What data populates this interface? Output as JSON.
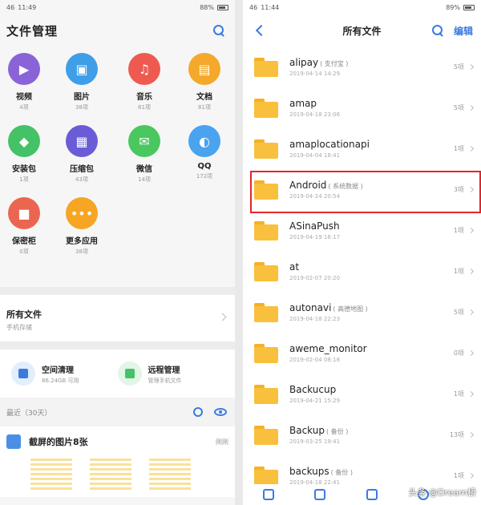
{
  "left": {
    "status": {
      "time": "11:49",
      "signal": "46",
      "battery": "88%"
    },
    "title": "文件管理",
    "categories": [
      {
        "name": "视频",
        "count": "4项",
        "color": "#8a63d8",
        "glyph": "▶"
      },
      {
        "name": "图片",
        "count": "38项",
        "color": "#3f9ee8",
        "glyph": "▣"
      },
      {
        "name": "音乐",
        "count": "81项",
        "color": "#ee5a4f",
        "glyph": "♫"
      },
      {
        "name": "文档",
        "count": "81项",
        "color": "#f4a92a",
        "glyph": "▤"
      },
      {
        "name": "安装包",
        "count": "1项",
        "color": "#45c267",
        "glyph": "◆"
      },
      {
        "name": "压缩包",
        "count": "43项",
        "color": "#6a5bd6",
        "glyph": "▦"
      },
      {
        "name": "微信",
        "count": "14项",
        "color": "#4ac75f",
        "glyph": "✉"
      },
      {
        "name": "QQ",
        "count": "172项",
        "color": "#49a3ef",
        "glyph": "◐"
      },
      {
        "name": "保密柜",
        "count": "0项",
        "color": "#ea6650",
        "glyph": "■"
      },
      {
        "name": "更多应用",
        "count": "38项",
        "color": "#f6a623",
        "glyph": "•••"
      }
    ],
    "all_files": {
      "title": "所有文件",
      "subtitle": "手机存储"
    },
    "tools": [
      {
        "title": "空间清理",
        "subtitle": "86.24GB 可用",
        "color": "#3b7be0"
      },
      {
        "title": "远程管理",
        "subtitle": "管理手机文件",
        "color": "#45c267"
      }
    ],
    "recent": {
      "label": "最近（30天）"
    },
    "screenshots": {
      "title": "截屏的图片8张",
      "time": "刚刚"
    }
  },
  "right": {
    "status": {
      "time": "11:44",
      "signal": "46",
      "battery": "89%"
    },
    "title": "所有文件",
    "edit_label": "编辑",
    "files": [
      {
        "name": "alipay",
        "tag": "( 支付宝 )",
        "date": "2019-04-14 14:29",
        "count": "5项"
      },
      {
        "name": "amap",
        "tag": "",
        "date": "2019-04-18 23:06",
        "count": "5项"
      },
      {
        "name": "amaplocationapi",
        "tag": "",
        "date": "2019-04-04 18:41",
        "count": "1项"
      },
      {
        "name": "Android",
        "tag": "( 系统数据 )",
        "date": "2019-04-24 20:54",
        "count": "3项"
      },
      {
        "name": "ASinaPush",
        "tag": "",
        "date": "2019-04-19 16:17",
        "count": "1项"
      },
      {
        "name": "at",
        "tag": "",
        "date": "2019-02-07 20:20",
        "count": "1项"
      },
      {
        "name": "autonavi",
        "tag": "( 高德地图 )",
        "date": "2019-04-18 22:23",
        "count": "5项"
      },
      {
        "name": "aweme_monitor",
        "tag": "",
        "date": "2019-02-04 08:18",
        "count": "0项"
      },
      {
        "name": "Backucup",
        "tag": "",
        "date": "2019-04-21 15:29",
        "count": "1项"
      },
      {
        "name": "Backup",
        "tag": "( 备份 )",
        "date": "2019-03-25 19:41",
        "count": "13项"
      },
      {
        "name": "backups",
        "tag": "( 备份 )",
        "date": "2019-04-18 22:41",
        "count": "1项"
      }
    ]
  },
  "watermark": "头条 @Dream桥"
}
